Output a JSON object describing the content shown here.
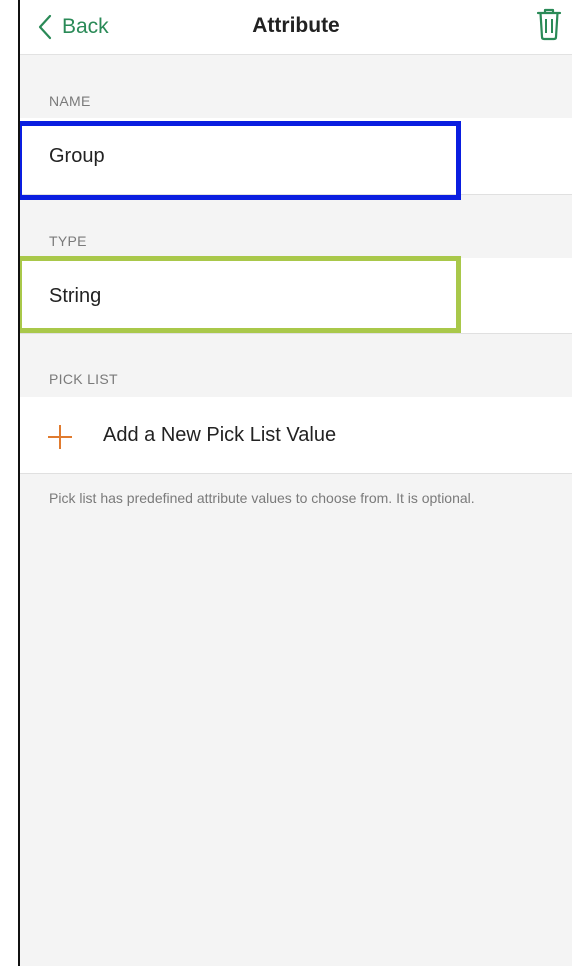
{
  "header": {
    "back_label": "Back",
    "title": "Attribute",
    "delete_icon": "trash-icon"
  },
  "name_section": {
    "label": "NAME",
    "value": "Group"
  },
  "type_section": {
    "label": "TYPE",
    "value": "String"
  },
  "pick_list_section": {
    "label": "PICK LIST",
    "add_label": "Add a New Pick List Value",
    "add_icon": "plus-icon",
    "help_text": "Pick list has predefined attribute values to choose from. It is optional."
  },
  "colors": {
    "accent": "#2a8a57",
    "plus": "#e07b2f",
    "highlight_name": "#0a1ee0",
    "highlight_type": "#a9c84a"
  }
}
